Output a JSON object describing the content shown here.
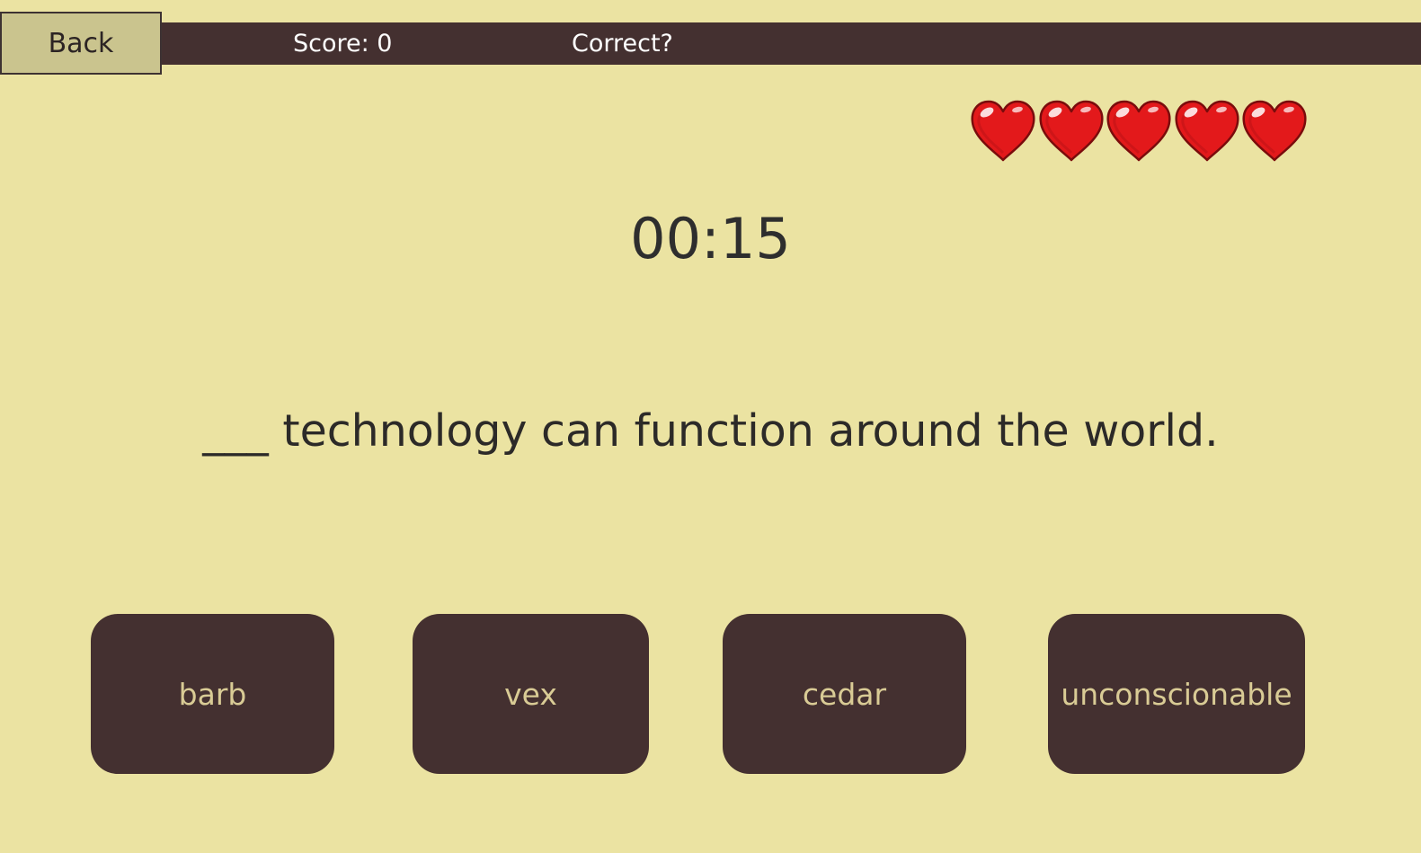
{
  "header": {
    "back_label": "Back",
    "score_text": "Score: 0",
    "correct_text": "Correct?"
  },
  "lives": {
    "count": 5,
    "icon": "heart-icon",
    "color": "#e3191b"
  },
  "timer": "00:15",
  "question": "___ technology can function around the world.",
  "answers": [
    "barb",
    "vex",
    "cedar",
    "unconscionable"
  ],
  "colors": {
    "background": "#ebe3a2",
    "bar": "#443030",
    "answer_text": "#d9cb95",
    "back_button": "#cac48e"
  }
}
